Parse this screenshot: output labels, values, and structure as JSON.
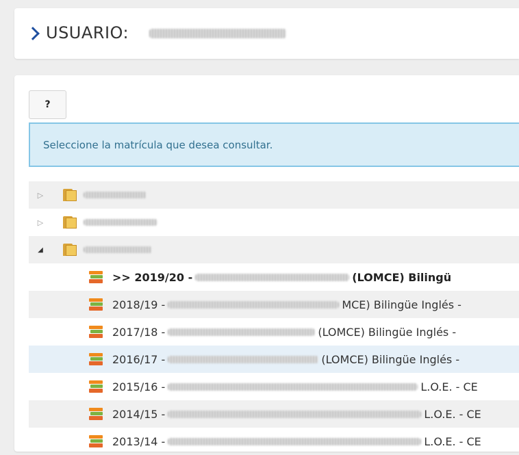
{
  "header": {
    "title": "USUARIO:"
  },
  "toolbar": {
    "help_label": "?"
  },
  "info": {
    "message": "Seleccione la matrícula que desea consultar."
  },
  "tree": {
    "folders": [
      {
        "state": "collapsed",
        "toggle": "▷"
      },
      {
        "state": "collapsed",
        "toggle": "▷"
      },
      {
        "state": "expanded",
        "toggle": "◢"
      }
    ],
    "enrollments": [
      {
        "prefix": ">> 2019/20 -",
        "suffix": "(LOMCE) Bilingü",
        "current": true
      },
      {
        "prefix": "2018/19 -",
        "suffix": "MCE) Bilingüe Inglés -",
        "current": false
      },
      {
        "prefix": "2017/18 -",
        "suffix": "(LOMCE) Bilingüe Inglés -",
        "current": false
      },
      {
        "prefix": "2016/17 -",
        "suffix": "(LOMCE) Bilingüe Inglés -",
        "current": false
      },
      {
        "prefix": "2015/16 -",
        "suffix": "L.O.E. - CE",
        "current": false
      },
      {
        "prefix": "2014/15 -",
        "suffix": "L.O.E. - CE",
        "current": false
      },
      {
        "prefix": "2013/14 -",
        "suffix": "L.O.E. - CE",
        "current": false
      }
    ]
  },
  "icons": {
    "chevron": "chevron-right-icon",
    "folder": "folder-icon",
    "enrollment": "book-stack-icon"
  },
  "colors": {
    "accent": "#1f4fa0",
    "info_bg": "#d9edf7",
    "info_border": "#85c6e6",
    "info_text": "#31708f",
    "row_alt": "#f0f0f0",
    "row_highlight": "#e6f0f8"
  }
}
